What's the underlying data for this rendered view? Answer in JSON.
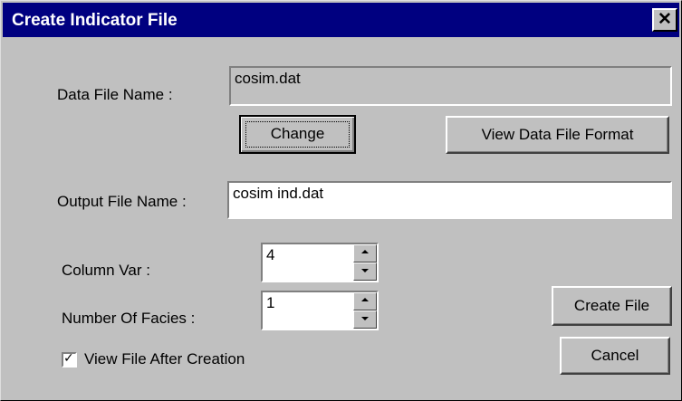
{
  "window": {
    "title": "Create Indicator File",
    "close_glyph": "✕",
    "title_bar_color": "#000080",
    "face_color": "#c0c0c0"
  },
  "data_file": {
    "label": "Data File Name :",
    "value": "cosim.dat",
    "change_button": "Change",
    "view_format_button": "View Data File Format"
  },
  "output_file": {
    "label": "Output File Name :",
    "value": "cosim ind.dat"
  },
  "column_var": {
    "label": "Column Var :",
    "value": "4"
  },
  "number_of_facies": {
    "label": "Number Of Facies :",
    "value": "1"
  },
  "view_after": {
    "label": "View File After Creation",
    "checked": true,
    "check_glyph": "✓"
  },
  "buttons": {
    "create_file": "Create File",
    "cancel": "Cancel"
  },
  "icons": {
    "close": "close-icon",
    "spin_up": "spin-up-arrow-icon",
    "spin_down": "spin-down-arrow-icon",
    "checkmark": "checkmark-icon"
  }
}
